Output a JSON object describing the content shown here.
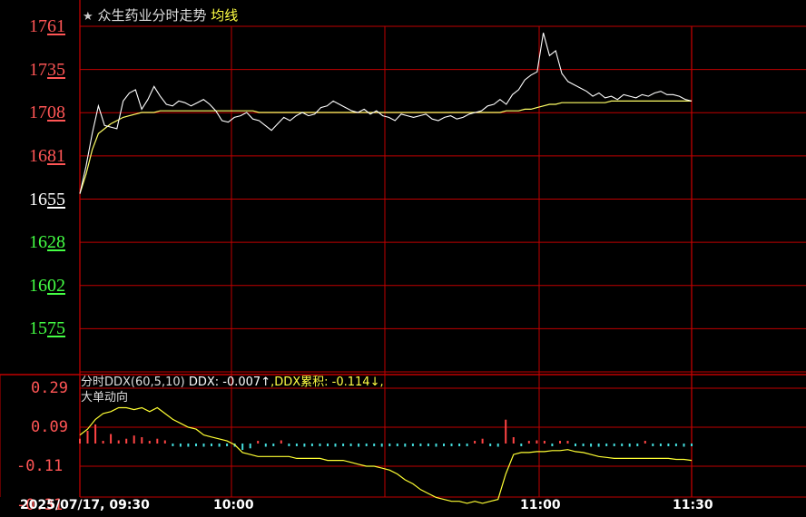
{
  "header": {
    "star": "★",
    "title": "众生药业分时走势",
    "avg_label": "均线"
  },
  "price_axis": {
    "ticks": [
      {
        "value": "1761",
        "color": "#ff5555",
        "underline": "61"
      },
      {
        "value": "1735",
        "color": "#ff5555",
        "underline": "35"
      },
      {
        "value": "1708",
        "color": "#ff5555",
        "underline": "08"
      },
      {
        "value": "1681",
        "color": "#ff5555",
        "underline": "81"
      },
      {
        "value": "1655",
        "color": "#ffffff",
        "underline": "55"
      },
      {
        "value": "1628",
        "color": "#44ff44",
        "underline": "28"
      },
      {
        "value": "1602",
        "color": "#44ff44",
        "underline": "02"
      },
      {
        "value": "1575",
        "color": "#44ff44",
        "underline": "75"
      }
    ]
  },
  "ddx_panel": {
    "indicator_label": "分时DDX(60,5,10)",
    "ddx_text": "DDX: -0.007↑",
    "ddx_sum_text": ",DDX累积: -0.114↓,",
    "big_order_label": "大单动向",
    "ticks": [
      "0.29",
      "0.09",
      "-0.11",
      "-0.31"
    ]
  },
  "time_axis": {
    "start": "2025/07/17, 09:30",
    "ticks": [
      "10:00",
      "11:00",
      "11:30"
    ]
  },
  "colors": {
    "grid": "#c00000",
    "price_line": "#ffffff",
    "avg_line": "#ffff66",
    "bar_up": "#ff4444",
    "bar_down": "#44dddd",
    "ddx_line": "#ffff33"
  },
  "chart_data": {
    "type": "line",
    "x_range": [
      "09:30",
      "11:30"
    ],
    "price_ylim": [
      1575,
      1761
    ],
    "series": [
      {
        "values": [
          1658,
          1675,
          1695,
          1712,
          1700,
          1699,
          1698,
          1715,
          1720,
          1722,
          1710,
          1716,
          1724,
          1718,
          1713,
          1712,
          1715,
          1714,
          1712,
          1714,
          1716,
          1713,
          1709,
          1703,
          1702,
          1705,
          1706,
          1708,
          1704,
          1703,
          1700,
          1697,
          1701,
          1705,
          1703,
          1706,
          1708,
          1706,
          1707,
          1711,
          1712,
          1715,
          1713,
          1711,
          1709,
          1708,
          1710,
          1707,
          1709,
          1706,
          1705,
          1703,
          1707,
          1706,
          1705,
          1706,
          1707,
          1704,
          1703,
          1705,
          1706,
          1704,
          1705,
          1707,
          1708,
          1709,
          1712,
          1713,
          1716,
          1713,
          1719,
          1722,
          1728,
          1731,
          1733,
          1757,
          1743,
          1746,
          1732,
          1727,
          1725,
          1723,
          1721,
          1718,
          1720,
          1717,
          1718,
          1716,
          1719,
          1718,
          1717,
          1719,
          1718,
          1720,
          1721,
          1719,
          1719,
          1718,
          1716,
          1715
        ]
      },
      {
        "values": [
          1658,
          1670,
          1685,
          1695,
          1698,
          1701,
          1703,
          1705,
          1706,
          1707,
          1708,
          1708,
          1708,
          1709,
          1709,
          1709,
          1709,
          1709,
          1709,
          1709,
          1709,
          1709,
          1709,
          1709,
          1709,
          1709,
          1709,
          1709,
          1709,
          1708,
          1708,
          1708,
          1708,
          1708,
          1708,
          1708,
          1708,
          1708,
          1708,
          1708,
          1708,
          1708,
          1708,
          1708,
          1708,
          1708,
          1708,
          1708,
          1708,
          1708,
          1708,
          1708,
          1708,
          1708,
          1708,
          1708,
          1708,
          1708,
          1708,
          1708,
          1708,
          1708,
          1708,
          1708,
          1708,
          1708,
          1708,
          1708,
          1708,
          1709,
          1709,
          1709,
          1710,
          1710,
          1711,
          1712,
          1713,
          1713,
          1714,
          1714,
          1714,
          1714,
          1714,
          1714,
          1714,
          1714,
          1715,
          1715,
          1715,
          1715,
          1715,
          1715,
          1715,
          1715,
          1715,
          1715,
          1715,
          1715,
          1715,
          1715
        ]
      }
    ],
    "ddx_ylim": [
      -0.31,
      0.29
    ],
    "ddx_line": [
      0.05,
      0.08,
      0.13,
      0.16,
      0.17,
      0.19,
      0.19,
      0.18,
      0.19,
      0.17,
      0.19,
      0.16,
      0.13,
      0.11,
      0.09,
      0.08,
      0.05,
      0.04,
      0.03,
      0.02,
      0.0,
      -0.04,
      -0.05,
      -0.06,
      -0.06,
      -0.06,
      -0.06,
      -0.06,
      -0.07,
      -0.07,
      -0.07,
      -0.07,
      -0.08,
      -0.08,
      -0.08,
      -0.09,
      -0.1,
      -0.11,
      -0.11,
      -0.12,
      -0.13,
      -0.15,
      -0.18,
      -0.2,
      -0.23,
      -0.25,
      -0.27,
      -0.28,
      -0.29,
      -0.29,
      -0.3,
      -0.29,
      -0.3,
      -0.29,
      -0.28,
      -0.15,
      -0.05,
      -0.04,
      -0.04,
      -0.035,
      -0.035,
      -0.03,
      -0.03,
      -0.025,
      -0.035,
      -0.04,
      -0.05,
      -0.06,
      -0.065,
      -0.07,
      -0.07,
      -0.07,
      -0.07,
      -0.07,
      -0.07,
      -0.07,
      -0.07,
      -0.075,
      -0.075,
      -0.08
    ],
    "ddx_bars": [
      0.03,
      0.08,
      0.12,
      0.0,
      0.06,
      0.02,
      0.03,
      0.05,
      0.04,
      0.0,
      0.03,
      0.02,
      -0.01,
      -0.02,
      -0.02,
      -0.01,
      -0.02,
      -0.01,
      -0.02,
      -0.01,
      -0.02,
      -0.04,
      -0.03,
      0.01,
      -0.02,
      -0.01,
      0.02,
      -0.01,
      -0.01,
      -0.02,
      -0.01,
      -0.01,
      -0.01,
      -0.02,
      -0.01,
      -0.01,
      -0.02,
      -0.01,
      -0.01,
      -0.02,
      -0.01,
      -0.01,
      -0.02,
      -0.01,
      -0.01,
      -0.01,
      -0.02,
      -0.01,
      -0.01,
      -0.01,
      -0.01,
      0.01,
      0.03,
      -0.01,
      -0.02,
      0.15,
      0.04,
      -0.01,
      0.01,
      0.02,
      0.01,
      -0.01,
      0.01,
      0.01,
      -0.01,
      -0.01,
      -0.02,
      -0.02,
      -0.01,
      -0.01,
      -0.01,
      -0.02,
      -0.01,
      0.01,
      -0.01,
      -0.01,
      -0.01,
      -0.01,
      -0.02,
      -0.01
    ]
  }
}
